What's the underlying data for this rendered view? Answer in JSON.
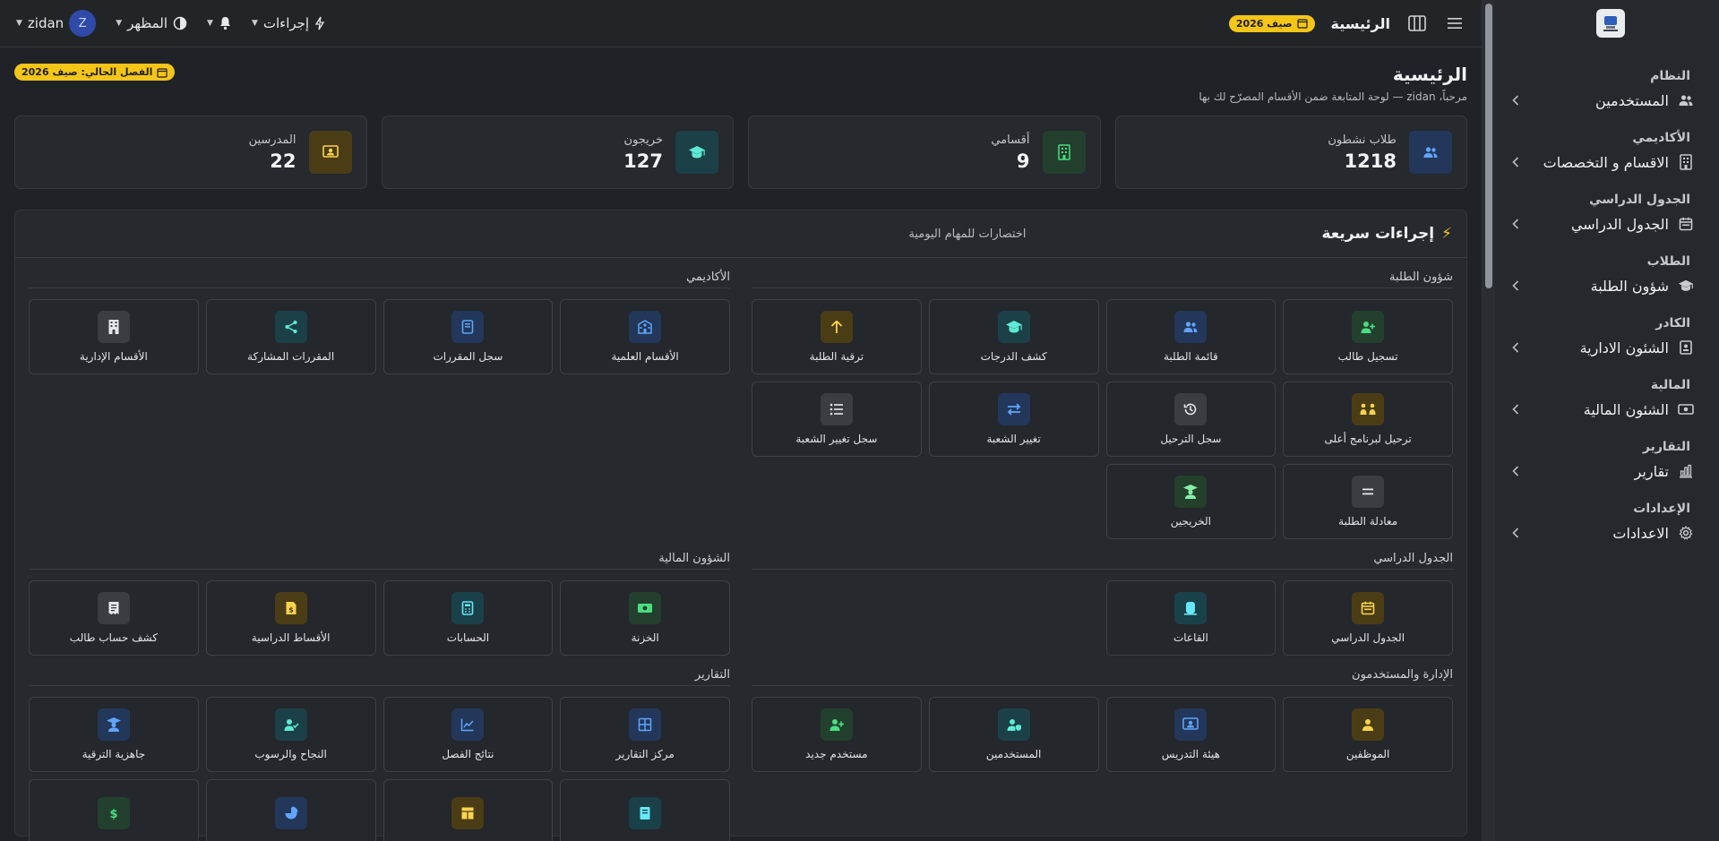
{
  "topbar": {
    "title": "الرئيسية",
    "term_badge": "صيف 2026",
    "actions_label": "إجراءات",
    "appearance_label": "المظهر",
    "user_name": "zidan",
    "user_initial": "Z"
  },
  "sidebar": {
    "sections": [
      {
        "heading": "النظام",
        "item": "المستخدمين",
        "icon": "users-icon"
      },
      {
        "heading": "الأكاديمي",
        "item": "الاقسام و التخصصات",
        "icon": "building-icon"
      },
      {
        "heading": "الجدول الدراسي",
        "item": "الجدول الدراسي",
        "icon": "calendar-icon"
      },
      {
        "heading": "الطلاب",
        "item": "شؤون الطلبة",
        "icon": "graduation-cap-icon"
      },
      {
        "heading": "الكادر",
        "item": "الشئون الادارية",
        "icon": "id-badge-icon"
      },
      {
        "heading": "المالية",
        "item": "الشئون المالية",
        "icon": "cash-icon"
      },
      {
        "heading": "التقارير",
        "item": "تقارير",
        "icon": "bar-chart-icon"
      },
      {
        "heading": "الإعدادات",
        "item": "الاعدادات",
        "icon": "gear-icon"
      }
    ]
  },
  "page": {
    "title": "الرئيسية",
    "subtitle": "مرحباً، zidan — لوحة المتابعة ضمن الأقسام المصرّح لك بها",
    "current_term": "الفصل الحالي: صيف 2026"
  },
  "stats": [
    {
      "label": "طلاب نشطون",
      "value": "1218",
      "icon": "users-icon",
      "color": "blue"
    },
    {
      "label": "أقسامي",
      "value": "9",
      "icon": "building-icon",
      "color": "green"
    },
    {
      "label": "خريجون",
      "value": "127",
      "icon": "graduation-cap-icon",
      "color": "teal"
    },
    {
      "label": "المدرسين",
      "value": "22",
      "icon": "teacher-icon",
      "color": "amber"
    }
  ],
  "quick": {
    "title": "إجراءات سريعة",
    "subtitle": "اختصارات للمهام اليومية",
    "groups": {
      "students": {
        "title": "شؤون الطلبة",
        "tiles": [
          {
            "label": "تسجيل طالب",
            "icon": "user-plus-icon",
            "color": "green"
          },
          {
            "label": "قائمة الطلبة",
            "icon": "users-icon",
            "color": "blue"
          },
          {
            "label": "كشف الدرجات",
            "icon": "graduation-cap-icon",
            "color": "teal"
          },
          {
            "label": "ترقية الطلبة",
            "icon": "arrow-up-icon",
            "color": "amber"
          },
          {
            "label": "ترحيل لبرنامج أعلى",
            "icon": "transfer-people-icon",
            "color": "amber"
          },
          {
            "label": "سجل الترحيل",
            "icon": "history-icon",
            "color": "gray"
          },
          {
            "label": "تغيير الشعبة",
            "icon": "swap-icon",
            "color": "blue"
          },
          {
            "label": "سجل تغيير الشعبة",
            "icon": "list-icon",
            "color": "gray"
          },
          {
            "label": "معادلة الطلبة",
            "icon": "equals-icon",
            "color": "gray"
          },
          {
            "label": "الخريجين",
            "icon": "graduate-icon",
            "color": "lime"
          }
        ]
      },
      "academic": {
        "title": "الأكاديمي",
        "tiles": [
          {
            "label": "الأقسام العلمية",
            "icon": "school-icon",
            "color": "blue"
          },
          {
            "label": "سجل المقررات",
            "icon": "book-icon",
            "color": "blue"
          },
          {
            "label": "المقررات المشاركة",
            "icon": "share-icon",
            "color": "teal"
          },
          {
            "label": "الأقسام الإدارية",
            "icon": "office-building-icon",
            "color": "gray"
          }
        ]
      },
      "schedule": {
        "title": "الجدول الدراسي",
        "tiles": [
          {
            "label": "الجدول الدراسي",
            "icon": "calendar-icon",
            "color": "amber"
          },
          {
            "label": "القاعات",
            "icon": "door-icon",
            "color": "cyan"
          }
        ]
      },
      "finance": {
        "title": "الشؤون المالية",
        "tiles": [
          {
            "label": "الخزنة",
            "icon": "money-icon",
            "color": "green"
          },
          {
            "label": "الحسابات",
            "icon": "calculator-icon",
            "color": "cyan"
          },
          {
            "label": "الأقساط الدراسية",
            "icon": "invoice-dollar-icon",
            "color": "amber"
          },
          {
            "label": "كشف حساب طالب",
            "icon": "receipt-icon",
            "color": "gray"
          }
        ]
      },
      "admin": {
        "title": "الإدارة والمستخدمون",
        "tiles": [
          {
            "label": "الموظفين",
            "icon": "employee-icon",
            "color": "amber"
          },
          {
            "label": "هيئة التدريس",
            "icon": "teacher-icon",
            "color": "blue"
          },
          {
            "label": "المستخدمين",
            "icon": "user-shield-icon",
            "color": "teal"
          },
          {
            "label": "مستخدم جديد",
            "icon": "user-plus-icon",
            "color": "green"
          }
        ]
      },
      "reports": {
        "title": "التقارير",
        "tiles": [
          {
            "label": "مركز التقارير",
            "icon": "grid-icon",
            "color": "blue"
          },
          {
            "label": "نتائج الفصل",
            "icon": "line-chart-icon",
            "color": "blue"
          },
          {
            "label": "النجاح والرسوب",
            "icon": "user-check-icon",
            "color": "teal"
          },
          {
            "label": "جاهزية الترقية",
            "icon": "graduate-icon",
            "color": "blue"
          },
          {
            "label": "",
            "icon": "document-icon",
            "color": "cyan"
          },
          {
            "label": "",
            "icon": "table-icon",
            "color": "amber"
          },
          {
            "label": "",
            "icon": "pie-chart-icon",
            "color": "blue"
          },
          {
            "label": "",
            "icon": "dollar-icon",
            "color": "green"
          }
        ]
      }
    }
  }
}
